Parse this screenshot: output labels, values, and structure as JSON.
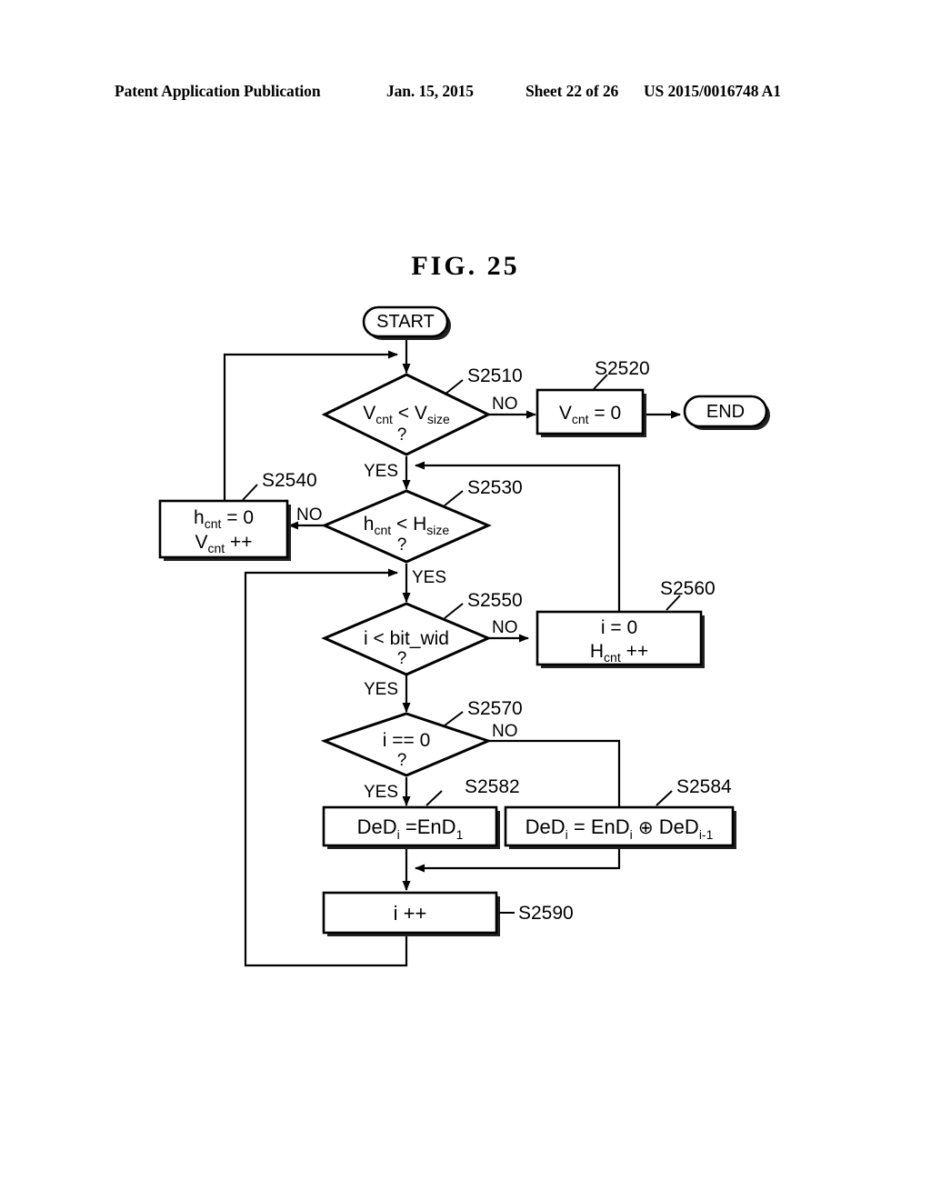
{
  "header": {
    "publication": "Patent Application Publication",
    "date": "Jan. 15, 2015",
    "sheet": "Sheet 22 of 26",
    "number": "US 2015/0016748 A1"
  },
  "figure": {
    "title": "FIG.  25",
    "type": "flowchart"
  },
  "flowchart": {
    "terminators": {
      "start": "START",
      "end": "END"
    },
    "nodes": [
      {
        "id": "S2510",
        "shape": "decision",
        "label_main": "V",
        "label_sub1": "cnt",
        "label_mid": "<",
        "label_main2": "V",
        "label_sub2": "size",
        "question": "?",
        "tag": "S2510"
      },
      {
        "id": "S2520",
        "shape": "process",
        "text": "V",
        "sub": "cnt",
        "rest": "= 0",
        "tag": "S2520"
      },
      {
        "id": "S2530",
        "shape": "decision",
        "label_main": "h",
        "label_sub1": "cnt",
        "label_mid": "<",
        "label_main2": "H",
        "label_sub2": "size",
        "question": "?",
        "tag": "S2530"
      },
      {
        "id": "S2540",
        "shape": "process",
        "line1_main": "h",
        "line1_sub": "cnt",
        "line1_rest": "= 0",
        "line2_main": "V",
        "line2_sub": "cnt",
        "line2_rest": "++",
        "tag": "S2540"
      },
      {
        "id": "S2550",
        "shape": "decision",
        "text": "i < bit_wid",
        "question": "?",
        "tag": "S2550"
      },
      {
        "id": "S2560",
        "shape": "process",
        "line1": "i = 0",
        "line2_main": "H",
        "line2_sub": "cnt",
        "line2_rest": "++",
        "tag": "S2560"
      },
      {
        "id": "S2570",
        "shape": "decision",
        "text": "i == 0",
        "question": "?",
        "tag": "S2570"
      },
      {
        "id": "S2582",
        "shape": "process",
        "p1": "DeD",
        "p1sub": "i",
        "p2": "=EnD",
        "p2sub": "1",
        "tag": "S2582"
      },
      {
        "id": "S2584",
        "shape": "process",
        "p1": "DeD",
        "p1sub": "i",
        "p2": "= EnD",
        "p2sub": "i",
        "op": "⊕",
        "p3": "DeD",
        "p3sub": "i-1",
        "tag": "S2584"
      },
      {
        "id": "S2590",
        "shape": "process",
        "text": "i ++",
        "tag": "S2590"
      }
    ],
    "branch_labels": {
      "s2510_no": "NO",
      "s2510_yes": "YES",
      "s2530_no": "NO",
      "s2530_yes": "YES",
      "s2550_no": "NO",
      "s2550_yes": "YES",
      "s2570_no": "NO",
      "s2570_yes": "YES"
    },
    "colors": {
      "line": "#000000",
      "fill": "#ffffff",
      "shadow": "#1a1a1a"
    }
  }
}
